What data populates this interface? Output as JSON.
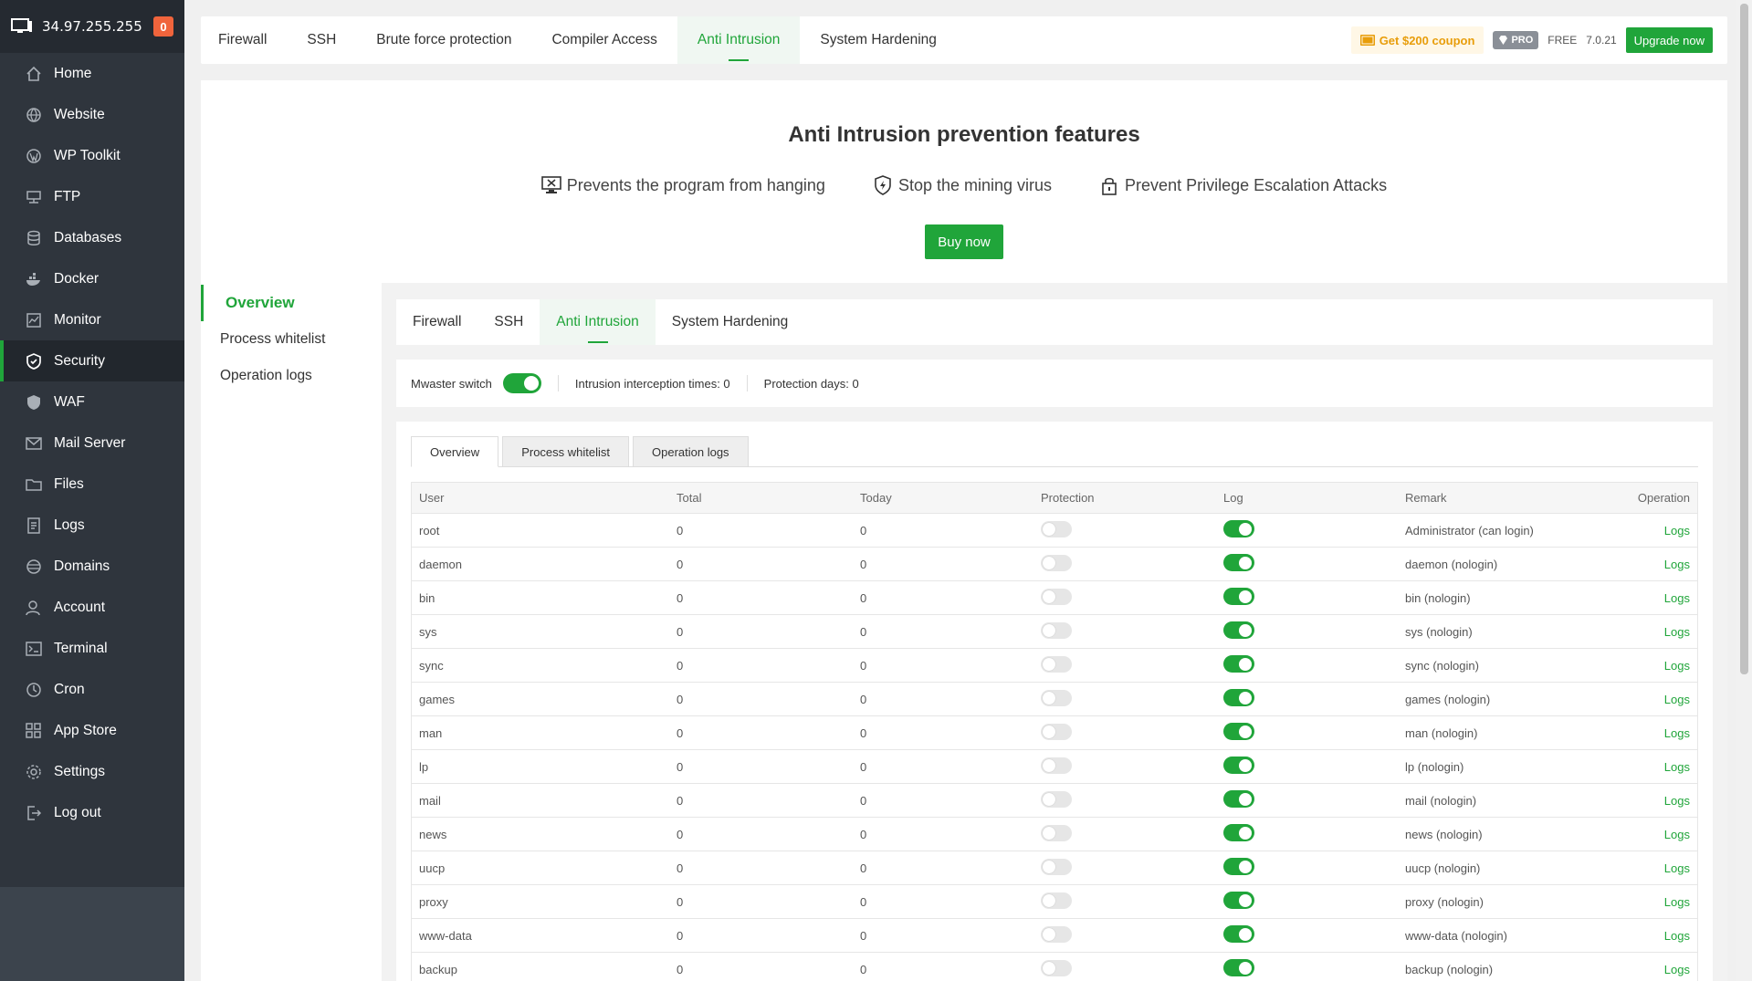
{
  "server": {
    "ip": "34.97.255.255",
    "alerts": "0"
  },
  "sidebar": {
    "items": [
      {
        "label": "Home",
        "icon": "home-icon"
      },
      {
        "label": "Website",
        "icon": "globe-icon"
      },
      {
        "label": "WP Toolkit",
        "icon": "wordpress-icon"
      },
      {
        "label": "FTP",
        "icon": "ftp-icon"
      },
      {
        "label": "Databases",
        "icon": "database-icon"
      },
      {
        "label": "Docker",
        "icon": "docker-icon"
      },
      {
        "label": "Monitor",
        "icon": "monitor-icon"
      },
      {
        "label": "Security",
        "icon": "shield-icon",
        "active": true
      },
      {
        "label": "WAF",
        "icon": "waf-shield-icon"
      },
      {
        "label": "Mail Server",
        "icon": "mail-icon"
      },
      {
        "label": "Files",
        "icon": "folder-icon"
      },
      {
        "label": "Logs",
        "icon": "logs-icon"
      },
      {
        "label": "Domains",
        "icon": "domains-icon"
      },
      {
        "label": "Account",
        "icon": "user-icon"
      },
      {
        "label": "Terminal",
        "icon": "terminal-icon"
      },
      {
        "label": "Cron",
        "icon": "clock-icon"
      },
      {
        "label": "App Store",
        "icon": "grid-icon"
      },
      {
        "label": "Settings",
        "icon": "gear-icon"
      },
      {
        "label": "Log out",
        "icon": "logout-icon"
      }
    ]
  },
  "top_tabs": [
    "Firewall",
    "SSH",
    "Brute force protection",
    "Compiler Access",
    "Anti Intrusion",
    "System Hardening"
  ],
  "top_right": {
    "coupon": "Get $200 coupon",
    "pro": "PRO",
    "edition": "FREE",
    "version": "7.0.21",
    "upgrade": "Upgrade now"
  },
  "promo": {
    "title": "Anti Intrusion prevention features",
    "features": [
      "Prevents the program from hanging",
      "Stop the mining virus",
      "Prevent Privilege Escalation Attacks"
    ],
    "buy": "Buy now"
  },
  "submenu": [
    "Overview",
    "Process whitelist",
    "Operation logs"
  ],
  "inner_tabs": [
    "Firewall",
    "SSH",
    "Anti Intrusion",
    "System Hardening"
  ],
  "switchbar": {
    "switch_label": "Mwaster switch",
    "interceptions": "Intrusion interception times: 0",
    "days": "Protection days: 0"
  },
  "panel_tabs": [
    "Overview",
    "Process whitelist",
    "Operation logs"
  ],
  "table": {
    "headers": [
      "User",
      "Total",
      "Today",
      "Protection",
      "Log",
      "Remark",
      "Operation"
    ],
    "rows": [
      {
        "user": "root",
        "total": "0",
        "today": "0",
        "remark": "Administrator (can login)",
        "op": "Logs"
      },
      {
        "user": "daemon",
        "total": "0",
        "today": "0",
        "remark": "daemon (nologin)",
        "op": "Logs"
      },
      {
        "user": "bin",
        "total": "0",
        "today": "0",
        "remark": "bin (nologin)",
        "op": "Logs"
      },
      {
        "user": "sys",
        "total": "0",
        "today": "0",
        "remark": "sys (nologin)",
        "op": "Logs"
      },
      {
        "user": "sync",
        "total": "0",
        "today": "0",
        "remark": "sync (nologin)",
        "op": "Logs"
      },
      {
        "user": "games",
        "total": "0",
        "today": "0",
        "remark": "games (nologin)",
        "op": "Logs"
      },
      {
        "user": "man",
        "total": "0",
        "today": "0",
        "remark": "man (nologin)",
        "op": "Logs"
      },
      {
        "user": "lp",
        "total": "0",
        "today": "0",
        "remark": "lp (nologin)",
        "op": "Logs"
      },
      {
        "user": "mail",
        "total": "0",
        "today": "0",
        "remark": "mail (nologin)",
        "op": "Logs"
      },
      {
        "user": "news",
        "total": "0",
        "today": "0",
        "remark": "news (nologin)",
        "op": "Logs"
      },
      {
        "user": "uucp",
        "total": "0",
        "today": "0",
        "remark": "uucp (nologin)",
        "op": "Logs"
      },
      {
        "user": "proxy",
        "total": "0",
        "today": "0",
        "remark": "proxy (nologin)",
        "op": "Logs"
      },
      {
        "user": "www-data",
        "total": "0",
        "today": "0",
        "remark": "www-data (nologin)",
        "op": "Logs"
      },
      {
        "user": "backup",
        "total": "0",
        "today": "0",
        "remark": "backup (nologin)",
        "op": "Logs"
      }
    ]
  },
  "colors": {
    "accent": "#20a53a",
    "sidebar": "#2f353d",
    "coupon": "#e89d0a"
  }
}
